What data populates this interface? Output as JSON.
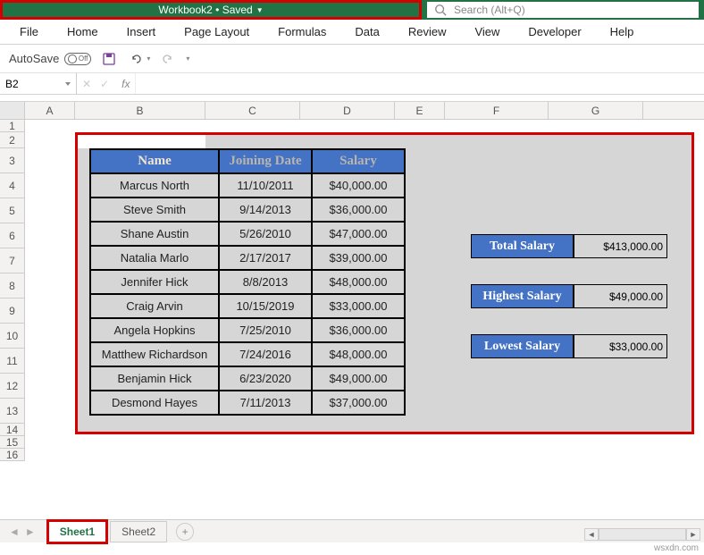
{
  "title": {
    "workbook": "Workbook2",
    "status": "Saved"
  },
  "search": {
    "placeholder": "Search (Alt+Q)"
  },
  "ribbon": {
    "tabs": [
      "File",
      "Home",
      "Insert",
      "Page Layout",
      "Formulas",
      "Data",
      "Review",
      "View",
      "Developer",
      "Help"
    ]
  },
  "qat": {
    "autosave_label": "AutoSave",
    "autosave_state": "Off"
  },
  "namebox": {
    "ref": "B2"
  },
  "fx": {
    "label": "fx"
  },
  "columns": [
    "A",
    "B",
    "C",
    "D",
    "E",
    "F",
    "G"
  ],
  "rows": [
    "1",
    "2",
    "3",
    "4",
    "5",
    "6",
    "7",
    "8",
    "9",
    "10",
    "11",
    "12",
    "13",
    "14",
    "15",
    "16"
  ],
  "table": {
    "headers": {
      "name": "Name",
      "date": "Joining Date",
      "salary": "Salary"
    },
    "rows": [
      {
        "name": "Marcus North",
        "date": "11/10/2011",
        "salary": "$40,000.00"
      },
      {
        "name": "Steve Smith",
        "date": "9/14/2013",
        "salary": "$36,000.00"
      },
      {
        "name": "Shane Austin",
        "date": "5/26/2010",
        "salary": "$47,000.00"
      },
      {
        "name": "Natalia Marlo",
        "date": "2/17/2017",
        "salary": "$39,000.00"
      },
      {
        "name": "Jennifer Hick",
        "date": "8/8/2013",
        "salary": "$48,000.00"
      },
      {
        "name": "Craig Arvin",
        "date": "10/15/2019",
        "salary": "$33,000.00"
      },
      {
        "name": "Angela Hopkins",
        "date": "7/25/2010",
        "salary": "$36,000.00"
      },
      {
        "name": "Matthew Richardson",
        "date": "7/24/2016",
        "salary": "$48,000.00"
      },
      {
        "name": "Benjamin Hick",
        "date": "6/23/2020",
        "salary": "$49,000.00"
      },
      {
        "name": "Desmond Hayes",
        "date": "7/11/2013",
        "salary": "$37,000.00"
      }
    ]
  },
  "summary": {
    "total": {
      "label": "Total Salary",
      "value": "$413,000.00"
    },
    "highest": {
      "label": "Highest Salary",
      "value": "$49,000.00"
    },
    "lowest": {
      "label": "Lowest Salary",
      "value": "$33,000.00"
    }
  },
  "sheets": {
    "active": "Sheet1",
    "other": "Sheet2"
  },
  "watermark": "wsxdn.com"
}
